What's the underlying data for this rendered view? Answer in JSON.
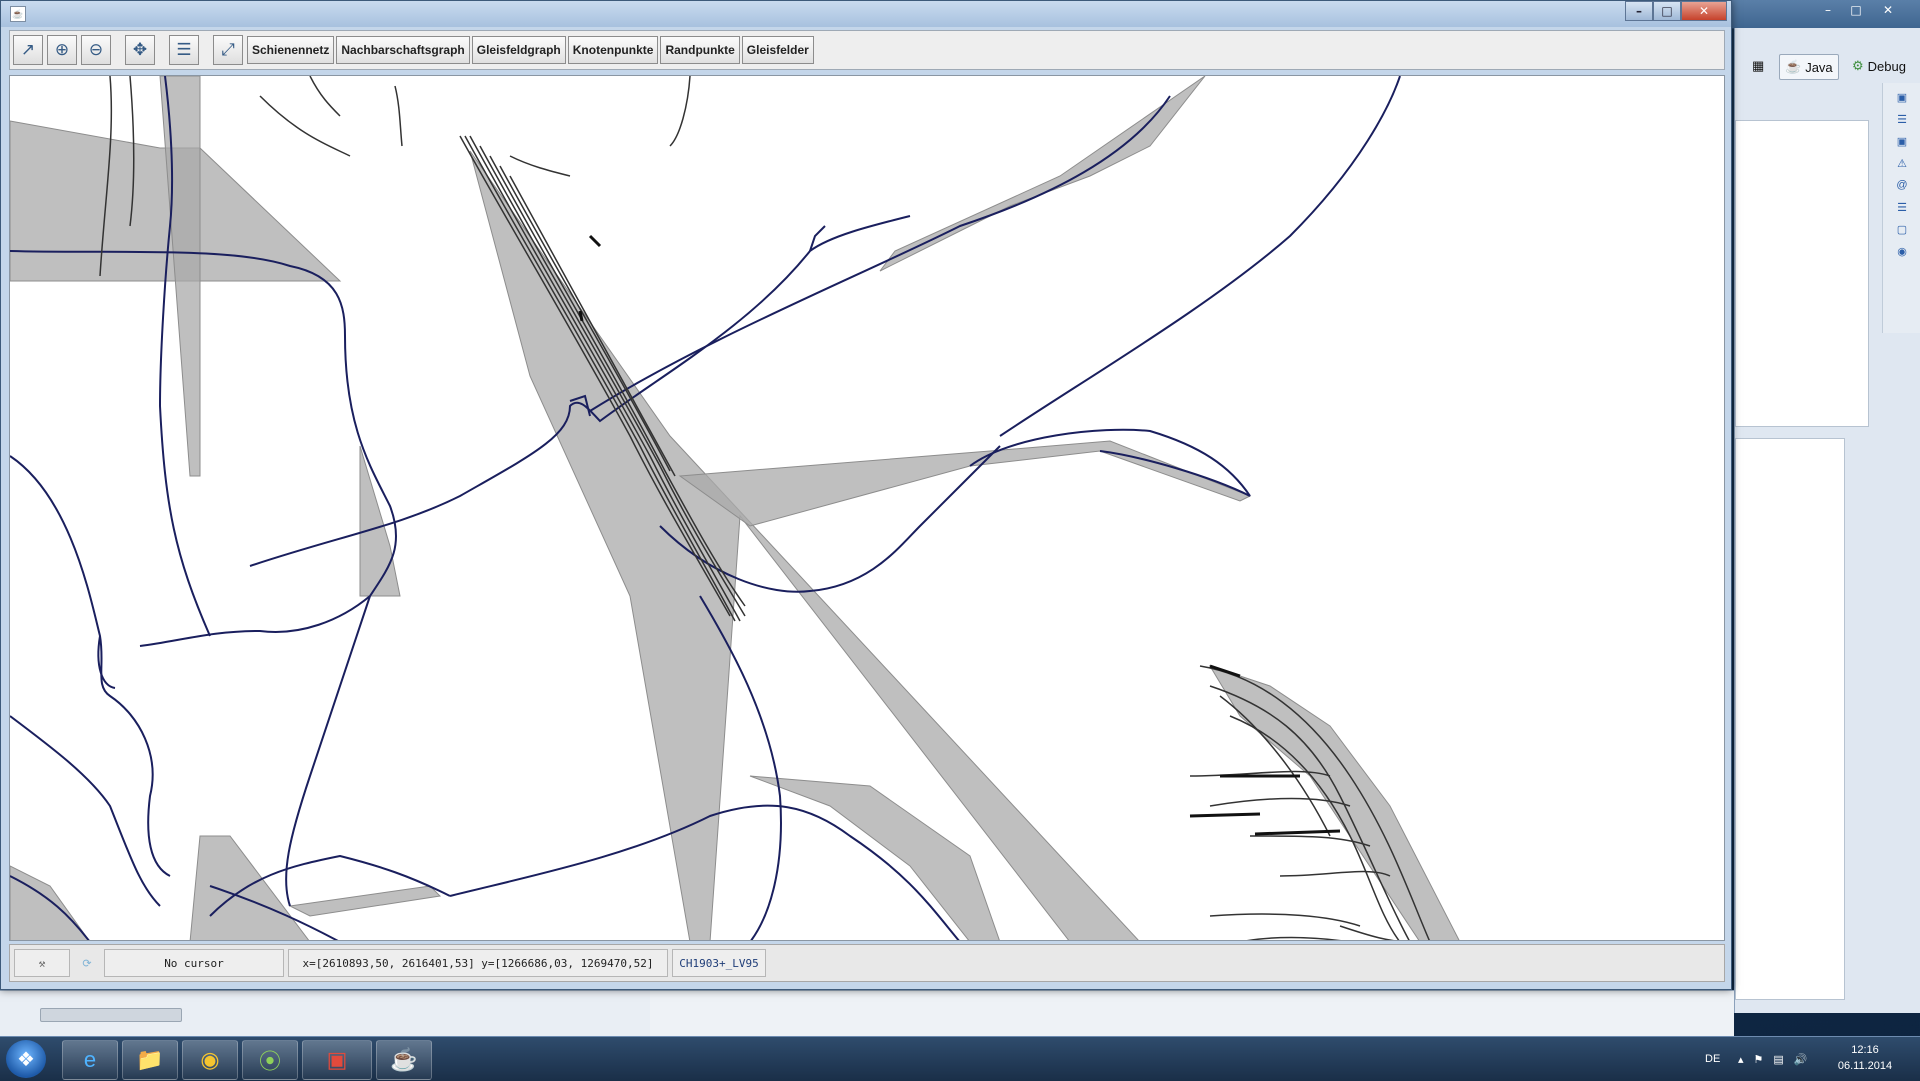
{
  "toolbar": {
    "buttons": [
      "Schienennetz",
      "Nachbarschaftsgraph",
      "Gleisfeldgraph",
      "Knotenpunkte",
      "Randpunkte",
      "Gleisfelder"
    ]
  },
  "status": {
    "cursor": "No cursor",
    "extent": "x=[2610893,50, 2616401,53] y=[1266686,03, 1269470,52]",
    "crs": "CH1903+_LV95"
  },
  "eclipse": {
    "perspective_java": "Java",
    "perspective_debug": "Debug"
  },
  "taskbar": {
    "language": "DE",
    "time": "12:16",
    "date": "06.11.2014"
  },
  "colors": {
    "track_line": "#1a1f5e",
    "polygon_fill": "#a9a9a9",
    "titlebar": "#a7c1de"
  }
}
